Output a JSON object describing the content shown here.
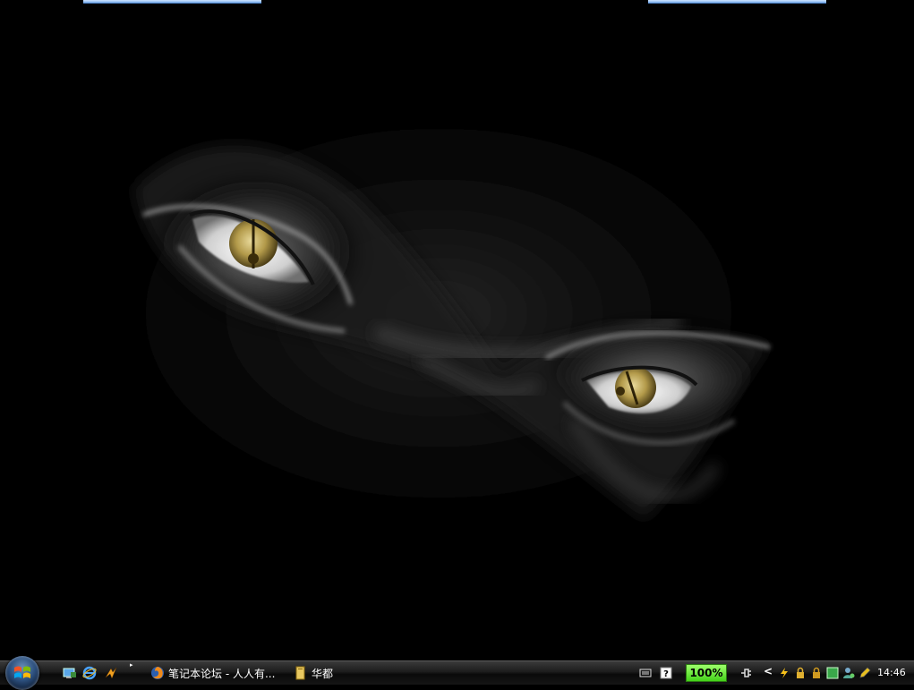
{
  "desktop": {
    "wallpaper_icon": "dark-face-glowing-eyes-wallpaper"
  },
  "taskbar": {
    "start_icon": "windows-logo-icon",
    "quick_launch": [
      {
        "icon": "show-desktop-icon"
      },
      {
        "icon": "internet-explorer-icon"
      },
      {
        "icon": "winamp-icon"
      }
    ],
    "tasks": [
      {
        "icon": "firefox-icon",
        "label": "笔记本论坛 - 人人有..."
      },
      {
        "icon": "folder-icon",
        "label": "华都"
      }
    ],
    "tray": {
      "battery_label": "100%",
      "battery_color": "#44d11a",
      "clock": "14:46"
    }
  }
}
